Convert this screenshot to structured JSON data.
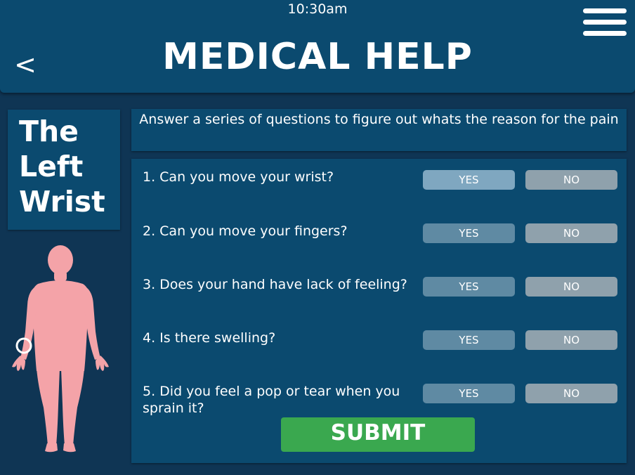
{
  "status_bar": {
    "time": "10:30am"
  },
  "header": {
    "back_label": "<",
    "title": "MEDICAL HELP",
    "menu_icon": "hamburger-menu-icon"
  },
  "body_part": {
    "title_lines": [
      "The",
      "Left",
      "Wrist"
    ],
    "figure_icon": "human-body-figure",
    "marker_icon": "circle-marker-icon"
  },
  "instruction": "Answer a series of questions to figure out whats the reason for the pain",
  "questions": [
    {
      "text": "1. Can you move your wrist?",
      "yes_label": "YES",
      "no_label": "NO",
      "selected": "yes"
    },
    {
      "text": "2. Can you move your fingers?",
      "yes_label": "YES",
      "no_label": "NO",
      "selected": ""
    },
    {
      "text": "3. Does your hand have lack of feeling?",
      "yes_label": "YES",
      "no_label": "NO",
      "selected": ""
    },
    {
      "text": "4. Is there swelling?",
      "yes_label": "YES",
      "no_label": "NO",
      "selected": ""
    },
    {
      "text": "5. Did you feel a pop or tear when you sprain it?",
      "yes_label": "YES",
      "no_label": "NO",
      "selected": ""
    }
  ],
  "submit_label": "SUBMIT",
  "colors": {
    "background": "#0f3554",
    "panel": "#0b4a6f",
    "yes_button": "#5f8aa3",
    "yes_selected": "#7fa7c0",
    "no_button": "#8fa1ac",
    "submit": "#3aa84f",
    "body_figure": "#f4a3a8"
  }
}
